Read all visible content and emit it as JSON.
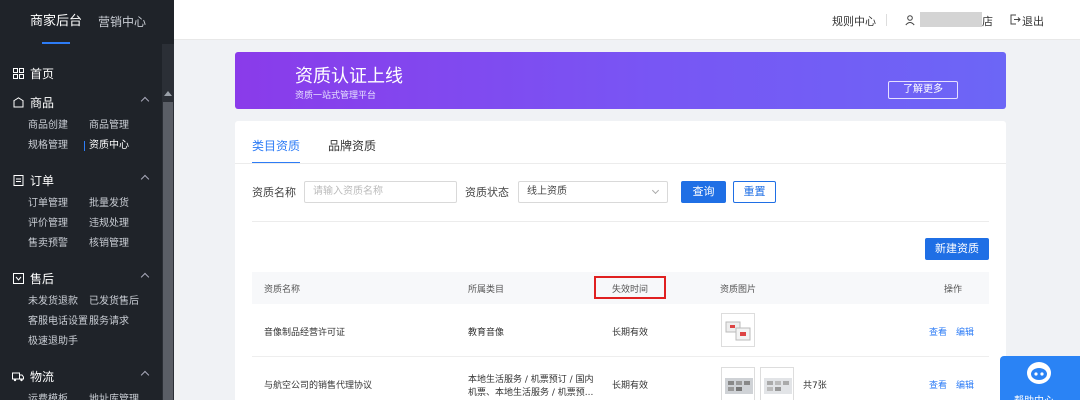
{
  "sidebar": {
    "tabs": [
      {
        "label": "商家后台",
        "active": true
      },
      {
        "label": "营销中心",
        "active": false
      }
    ],
    "groups": [
      {
        "label": "首页",
        "icon": "grid-icon",
        "items": []
      },
      {
        "label": "商品",
        "icon": "shop-icon",
        "items": [
          "商品创建",
          "商品管理",
          "规格管理",
          "资质中心"
        ],
        "active_item": "资质中心"
      },
      {
        "label": "订单",
        "icon": "order-icon",
        "items": [
          "订单管理",
          "批量发货",
          "评价管理",
          "违规处理",
          "售卖预警",
          "核销管理"
        ]
      },
      {
        "label": "售后",
        "icon": "aftersale-icon",
        "items": [
          "未发货退款",
          "已发货售后",
          "客服电话设置",
          "服务请求",
          "极速退助手"
        ]
      },
      {
        "label": "物流",
        "icon": "truck-icon",
        "items": [
          "运费模板",
          "地址库管理"
        ]
      }
    ]
  },
  "topbar": {
    "rules": "规则中心",
    "user_suffix": "店",
    "logout": "退出"
  },
  "banner": {
    "title": "资质认证上线",
    "subtitle": "资质一站式管理平台",
    "button": "了解更多"
  },
  "tabs": [
    {
      "label": "类目资质",
      "active": true
    },
    {
      "label": "品牌资质",
      "active": false
    }
  ],
  "filter": {
    "name_label": "资质名称",
    "name_placeholder": "请输入资质名称",
    "status_label": "资质状态",
    "status_value": "线上资质",
    "query": "查询",
    "reset": "重置"
  },
  "new_button": "新建资质",
  "table": {
    "headers": [
      "资质名称",
      "所属类目",
      "失效时间",
      "资质图片",
      "操作"
    ],
    "rows": [
      {
        "name": "音像制品经营许可证",
        "category": "教育音像",
        "category2": "",
        "expire": "长期有效",
        "count": "",
        "view": "查看",
        "edit": "编辑"
      },
      {
        "name": "与航空公司的销售代理协议",
        "category": "本地生活服务 / 机票预订 / 国内",
        "category2": "机票、本地生活服务 / 机票预...",
        "expire": "长期有效",
        "count": "共7张",
        "view": "查看",
        "edit": "编辑"
      }
    ]
  },
  "help": {
    "label": "帮助中心"
  },
  "colors": {
    "accent": "#2d7cf6",
    "sidebar": "#1f2329",
    "banner_start": "#8a3bea",
    "banner_end": "#6c66f6",
    "highlight": "#e02020"
  }
}
